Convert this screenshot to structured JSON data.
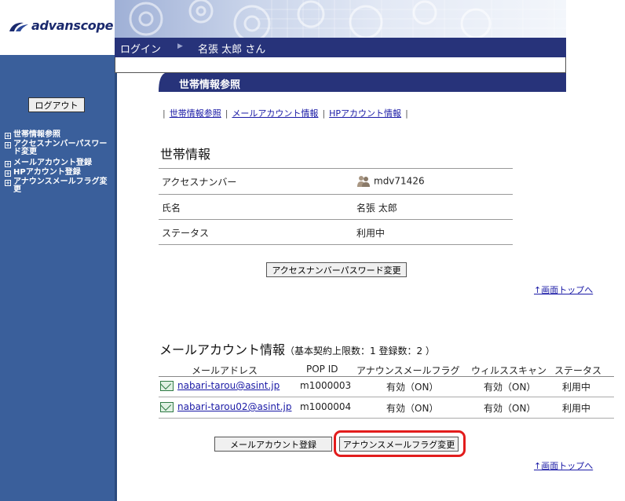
{
  "app": {
    "logo_text": "advanscope"
  },
  "navbar": {
    "login_label": "ログイン",
    "user_label": "名張 太郎 さん"
  },
  "sidebar": {
    "logout_label": "ログアウト",
    "items": [
      {
        "label": "世帯情報参照"
      },
      {
        "label": "アクセスナンバーパスワード変更"
      },
      {
        "label": "メールアカウント登録"
      },
      {
        "label": "HPアカウント登録"
      },
      {
        "label": "アナウンスメールフラグ変更"
      }
    ]
  },
  "section": {
    "title": "世帯情報参照"
  },
  "subnav": {
    "items": [
      "世帯情報参照",
      "メールアカウント情報",
      "HPアカウント情報"
    ]
  },
  "household": {
    "heading": "世帯情報",
    "rows": [
      {
        "label": "アクセスナンバー",
        "value": "mdv71426",
        "icon": "users-icon"
      },
      {
        "label": "氏名",
        "value": "名張 太郎"
      },
      {
        "label": "ステータス",
        "value": "利用中"
      }
    ],
    "change_password_button": "アクセスナンバーパスワード変更",
    "top_link": "↑画面トップへ"
  },
  "mail": {
    "heading": "メールアカウント情報",
    "summary": "（基本契約上限数：1 登録数：2 ）",
    "columns": [
      "メールアドレス",
      "POP ID",
      "アナウンスメールフラグ",
      "ウィルススキャン",
      "ステータス"
    ],
    "rows": [
      {
        "address": "nabari-tarou@asint.jp",
        "pop_id": "m1000003",
        "announce": "有効（ON）",
        "virus": "有効（ON）",
        "status": "利用中"
      },
      {
        "address": "nabari-tarou02@asint.jp",
        "pop_id": "m1000004",
        "announce": "有効（ON）",
        "virus": "有効（ON）",
        "status": "利用中"
      }
    ],
    "register_button": "メールアカウント登録",
    "flag_change_button": "アナウンスメールフラグ変更",
    "top_link": "↑画面トップへ"
  },
  "colors": {
    "navbar": "#27337a",
    "sidebar": "#3a5f9b",
    "highlight": "#e21c1c"
  }
}
